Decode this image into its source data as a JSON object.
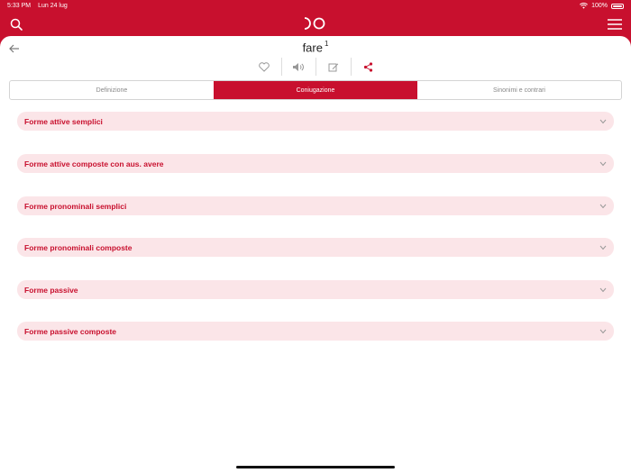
{
  "status_bar": {
    "time": "5:33 PM",
    "date": "Lun 24 lug",
    "battery": "100%"
  },
  "icons": {
    "search": "search-icon",
    "logo": "logo-icon",
    "menu": "hamburger-menu-icon",
    "back": "back-arrow-icon",
    "favorite": "heart-icon",
    "audio": "speaker-icon",
    "note": "edit-note-icon",
    "share": "share-icon",
    "chevron": "chevron-down-icon"
  },
  "colors": {
    "brand": "#c8102e",
    "accordion_bg": "#fbe5e8"
  },
  "entry": {
    "word": "fare",
    "sense_number": "1"
  },
  "tabs": [
    {
      "label": "Definizione",
      "active": false
    },
    {
      "label": "Coniugazione",
      "active": true
    },
    {
      "label": "Sinonimi e contrari",
      "active": false
    }
  ],
  "sections": [
    {
      "label": "Forme attive semplici"
    },
    {
      "label": "Forme attive composte con aus. avere"
    },
    {
      "label": "Forme pronominali semplici"
    },
    {
      "label": "Forme pronominali composte"
    },
    {
      "label": "Forme passive"
    },
    {
      "label": "Forme passive composte"
    }
  ]
}
